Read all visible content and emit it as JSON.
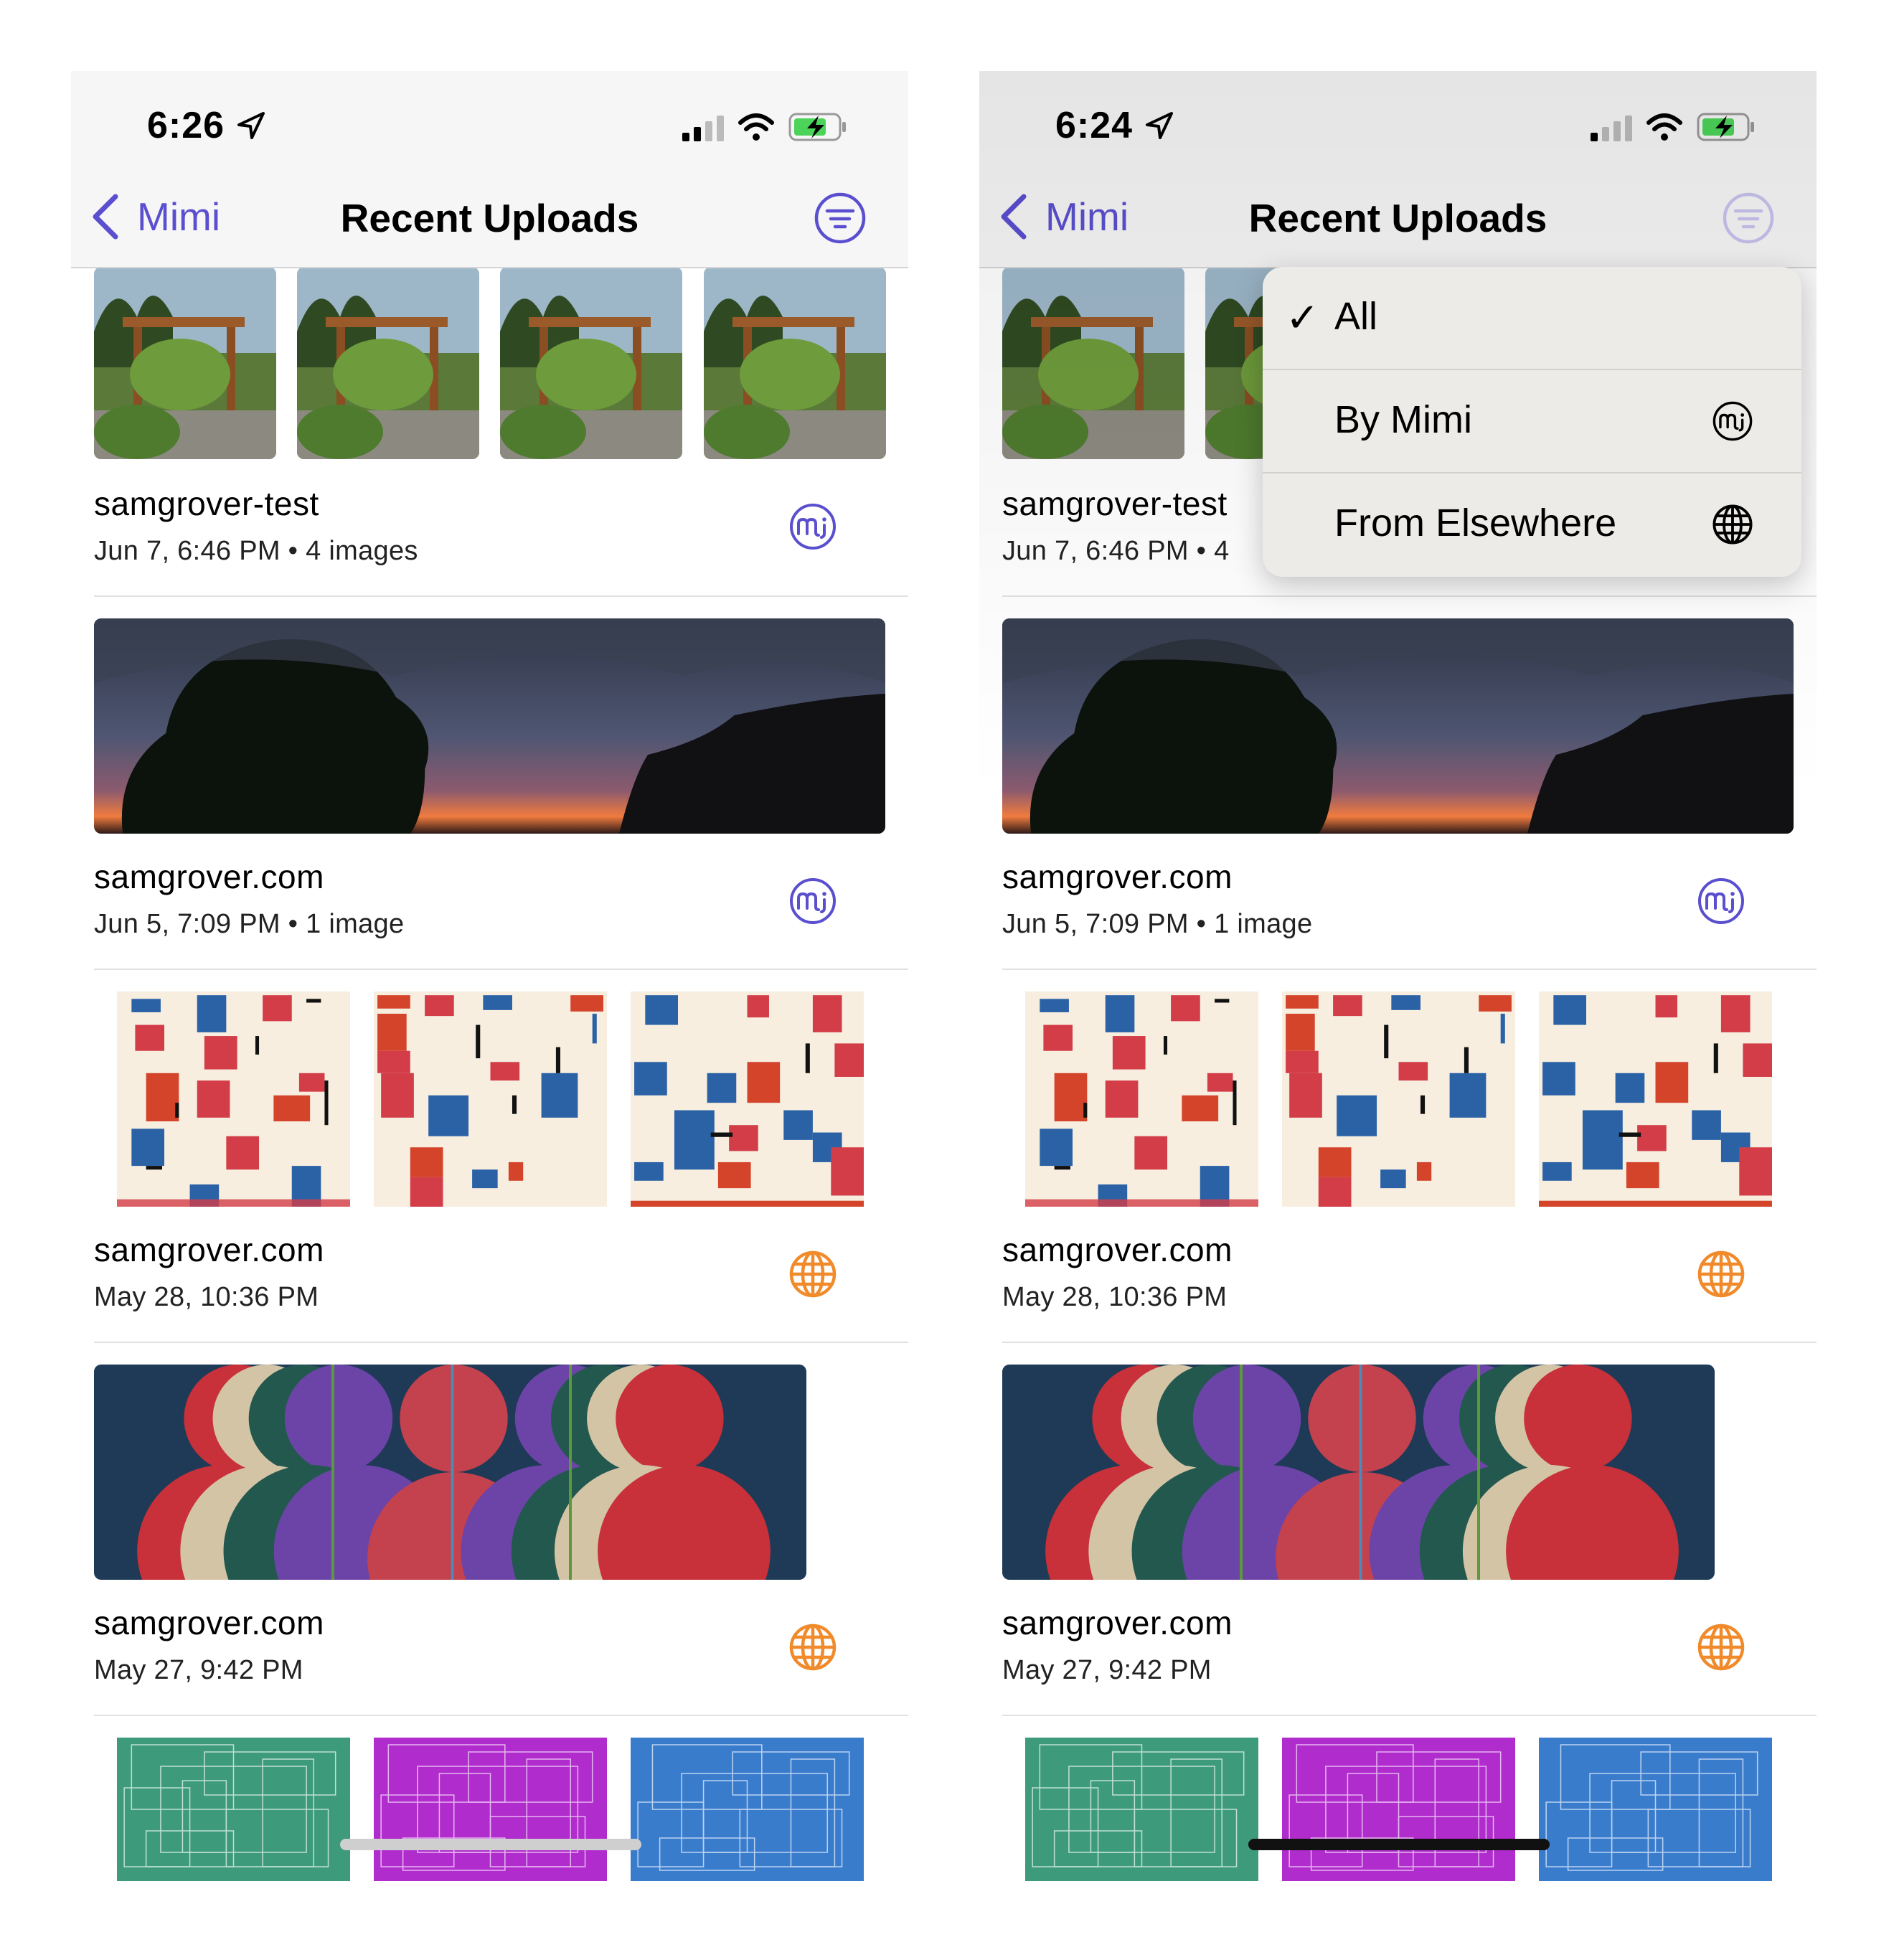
{
  "colors": {
    "accent": "#5a4fcf",
    "elsewhere": "#f08a2a"
  },
  "screens": [
    {
      "status": {
        "time": "6:26"
      },
      "nav": {
        "back_label": "Mimi",
        "title": "Recent Uploads"
      },
      "entries": [
        {
          "title": "samgrover-test",
          "meta": "Jun 7, 6:46 PM • 4 images",
          "source_icon": "mimi-logo-icon"
        },
        {
          "title": "samgrover.com",
          "meta": "Jun 5, 7:09 PM • 1 image",
          "source_icon": "mimi-logo-icon"
        },
        {
          "title": "samgrover.com",
          "meta": "May 28, 10:36 PM",
          "source_icon": "globe-icon"
        },
        {
          "title": "samgrover.com",
          "meta": "May 27, 9:42 PM",
          "source_icon": "globe-icon"
        }
      ]
    },
    {
      "status": {
        "time": "6:24"
      },
      "nav": {
        "back_label": "Mimi",
        "title": "Recent Uploads"
      },
      "entries": [
        {
          "title": "samgrover-test",
          "meta": "Jun 7, 6:46 PM • 4",
          "source_icon": "mimi-logo-icon"
        },
        {
          "title": "samgrover.com",
          "meta": "Jun 5, 7:09 PM • 1 image",
          "source_icon": "mimi-logo-icon"
        },
        {
          "title": "samgrover.com",
          "meta": "May 28, 10:36 PM",
          "source_icon": "globe-icon"
        },
        {
          "title": "samgrover.com",
          "meta": "May 27, 9:42 PM",
          "source_icon": "globe-icon"
        }
      ],
      "filter_menu": {
        "items": [
          {
            "label": "All",
            "checked": true,
            "icon": ""
          },
          {
            "label": "By Mimi",
            "checked": false,
            "icon": "mimi-logo-icon"
          },
          {
            "label": "From Elsewhere",
            "checked": false,
            "icon": "globe-icon"
          }
        ],
        "check_mark": "✓"
      }
    }
  ]
}
